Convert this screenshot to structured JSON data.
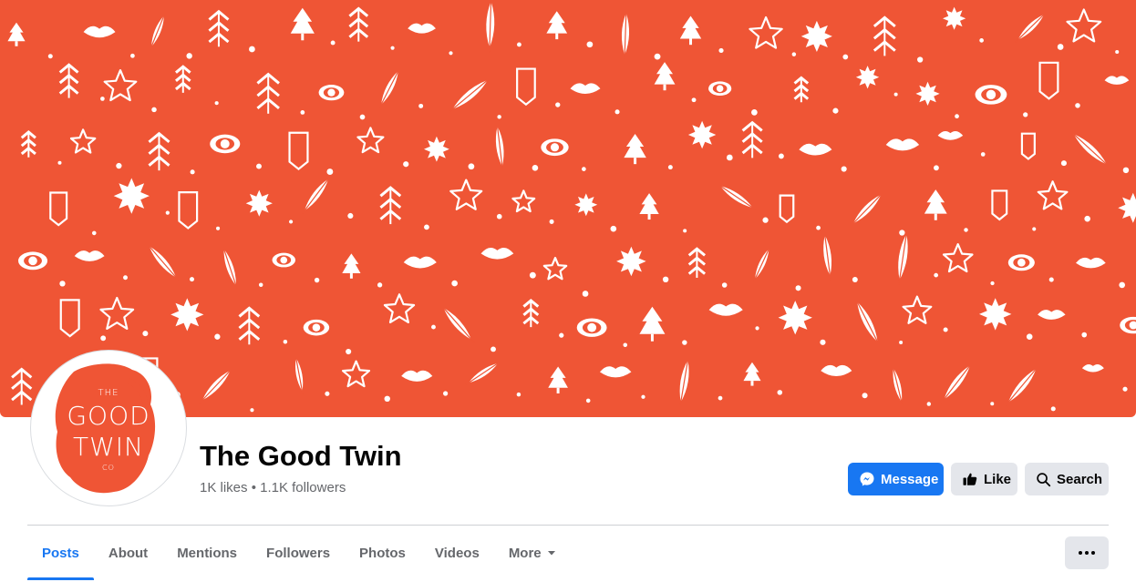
{
  "cover": {
    "background": "#ef5535",
    "pattern": "white doodle icons: stars, trees, eyes, lips, feathers, gems"
  },
  "profile": {
    "logo_lines": [
      "THE",
      "GOOD",
      "TWIN",
      "CO"
    ],
    "name": "The Good Twin",
    "stats": "1K likes • 1.1K followers"
  },
  "actions": {
    "message_label": "Message",
    "like_label": "Like",
    "search_label": "Search",
    "more_icon": "ellipsis-icon"
  },
  "tabs": [
    {
      "label": "Posts",
      "active": true
    },
    {
      "label": "About"
    },
    {
      "label": "Mentions"
    },
    {
      "label": "Followers"
    },
    {
      "label": "Photos"
    },
    {
      "label": "Videos"
    },
    {
      "label": "More"
    }
  ],
  "colors": {
    "accent": "#1877f2",
    "brand": "#ef5535",
    "button_gray": "#e4e6eb",
    "muted_text": "#65676b"
  }
}
